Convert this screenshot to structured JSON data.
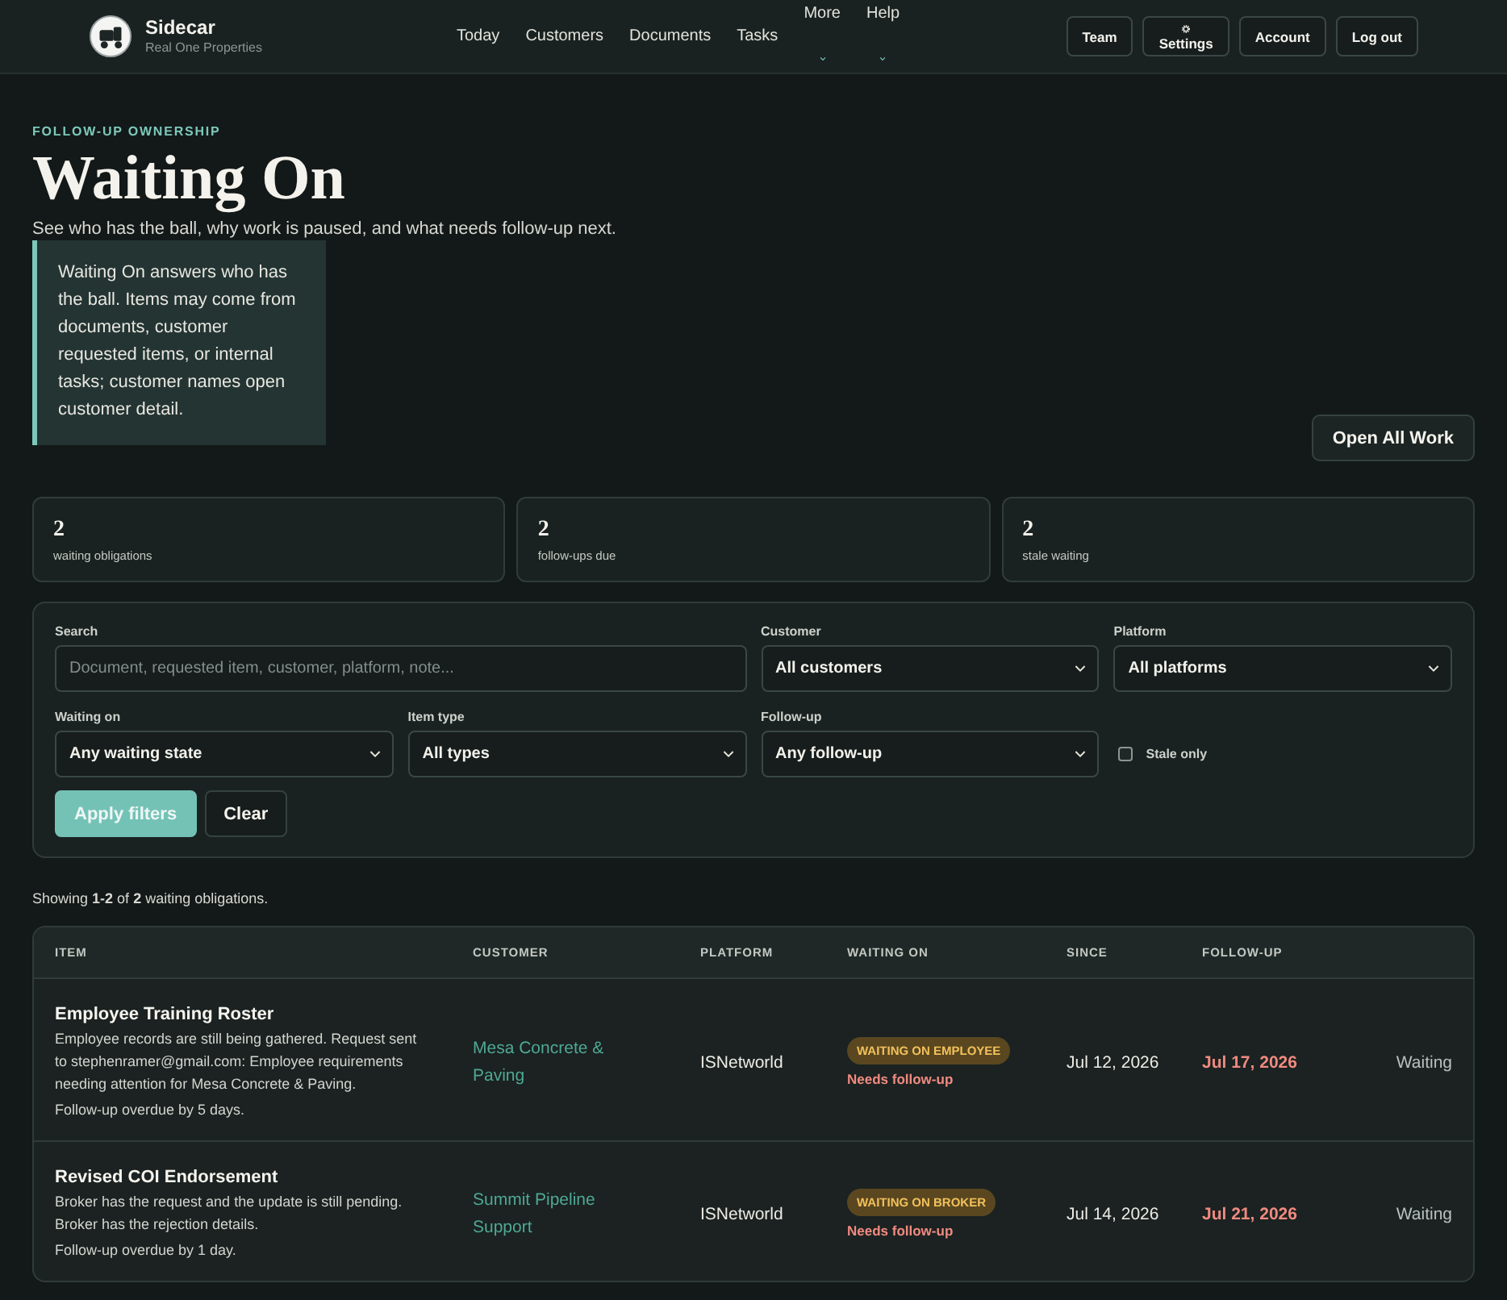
{
  "header": {
    "brand": {
      "name": "Sidecar",
      "subtitle": "Real One Properties"
    },
    "nav": [
      {
        "label": "Today",
        "kind": "link"
      },
      {
        "label": "Customers",
        "kind": "link"
      },
      {
        "label": "Documents",
        "kind": "link"
      },
      {
        "label": "Tasks",
        "kind": "link"
      },
      {
        "label": "More",
        "kind": "menu"
      },
      {
        "label": "Help",
        "kind": "menu"
      }
    ],
    "actions": [
      {
        "label": "Team",
        "kind": "plain"
      },
      {
        "label": "Settings",
        "kind": "gear"
      },
      {
        "label": "Account",
        "kind": "plain"
      },
      {
        "label": "Log out",
        "kind": "plain"
      }
    ]
  },
  "page": {
    "eyebrow": "FOLLOW-UP OWNERSHIP",
    "title": "Waiting On",
    "subtitle": "See who has the ball, why work is paused, and what needs follow-up next.",
    "callout": "Waiting On answers who has the ball. Items may come from documents, customer requested items, or internal tasks; customer names open customer detail.",
    "action": "Open All Work"
  },
  "stats": [
    {
      "value": "2",
      "label": "waiting obligations"
    },
    {
      "value": "2",
      "label": "follow-ups due"
    },
    {
      "value": "2",
      "label": "stale waiting"
    }
  ],
  "filters": {
    "search": {
      "label": "Search",
      "placeholder": "Document, requested item, customer, platform, note..."
    },
    "selects": [
      {
        "label": "Customer",
        "value": "All customers"
      },
      {
        "label": "Platform",
        "value": "All platforms"
      },
      {
        "label": "Waiting on",
        "value": "Any waiting state"
      },
      {
        "label": "Item type",
        "value": "All types"
      },
      {
        "label": "Follow-up",
        "value": "Any follow-up"
      }
    ],
    "stale_only": {
      "label": "Stale only",
      "checked": false
    },
    "buttons": [
      {
        "label": "Apply filters",
        "kind": "primary"
      },
      {
        "label": "Clear",
        "kind": "secondary"
      }
    ]
  },
  "results_summary": "Showing **1-2** of **2** waiting obligations.",
  "table": {
    "columns": [
      "ITEM",
      "CUSTOMER",
      "PLATFORM",
      "WAITING ON",
      "SINCE",
      "FOLLOW-UP"
    ],
    "rows": [
      {
        "title": "Employee Training Roster",
        "description": "Employee records are still being gathered. Request sent to stephenramer@gmail.com: Employee requirements needing attention for Mesa Concrete & Paving.",
        "note": "Follow-up overdue by 5 days.",
        "customer": "Mesa Concrete & Paving",
        "platform": "ISNetworld",
        "waiting_on": "WAITING ON EMPLOYEE",
        "waiting_note": "Needs follow-up",
        "since": "Jul 12, 2026",
        "follow_up": "Jul 17, 2026",
        "follow_up_overdue": true,
        "column_7": "Waiting"
      },
      {
        "title": "Revised COI Endorsement",
        "description": "Broker has the request and the update is still pending. Broker has the rejection details.",
        "note": "Follow-up overdue by 1 day.",
        "customer": "Summit Pipeline Support",
        "platform": "ISNetworld",
        "waiting_on": "WAITING ON BROKER",
        "waiting_note": "Needs follow-up",
        "since": "Jul 14, 2026",
        "follow_up": "Jul 21, 2026",
        "follow_up_overdue": true,
        "column_7": "Waiting"
      }
    ]
  }
}
